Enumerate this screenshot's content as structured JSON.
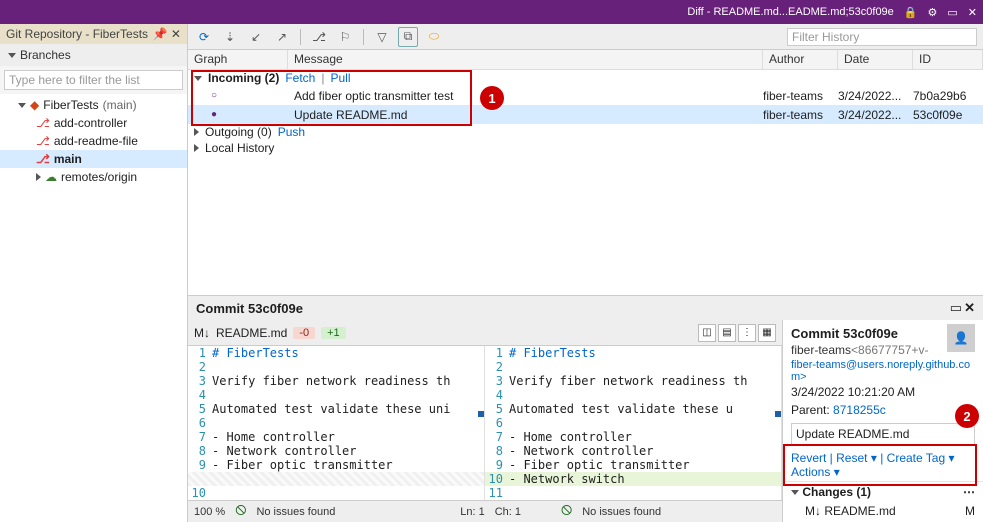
{
  "titlebar": {
    "diff_label": "Diff - README.md...EADME.md;53c0f09e"
  },
  "left": {
    "tab_title": "Git Repository - FiberTests",
    "branches_label": "Branches",
    "filter_placeholder": "Type here to filter the list",
    "repo_name": "FiberTests",
    "repo_branch_suffix": "(main)",
    "branches": [
      "add-controller",
      "add-readme-file",
      "main"
    ],
    "remotes_label": "remotes/origin"
  },
  "toolbar": {
    "filter_history_placeholder": "Filter History"
  },
  "columns": {
    "graph": "Graph",
    "message": "Message",
    "author": "Author",
    "date": "Date",
    "id": "ID"
  },
  "history": {
    "incoming_label": "Incoming (2)",
    "fetch_label": "Fetch",
    "pull_label": "Pull",
    "rows": [
      {
        "message": "Add fiber optic transmitter test",
        "author": "fiber-teams",
        "date": "3/24/2022...",
        "id": "7b0a29b6"
      },
      {
        "message": "Update README.md",
        "author": "fiber-teams",
        "date": "3/24/2022...",
        "id": "53c0f09e"
      }
    ],
    "outgoing_label": "Outgoing (0)",
    "push_label": "Push",
    "local_history_label": "Local History"
  },
  "commit": {
    "header": "Commit 53c0f09e",
    "file": "README.md",
    "removed": "-0",
    "added": "+1",
    "left_lines": [
      "# FiberTests",
      "",
      "Verify fiber network readiness th",
      "",
      "Automated test validate these uni",
      "",
      "- Home controller",
      "- Network controller",
      "- Fiber optic transmitter"
    ],
    "left_del_line_no": "",
    "left_trailing_no": "10",
    "right_lines": [
      "# FiberTests",
      "",
      "Verify fiber network readiness th",
      "",
      "Automated test validate these u",
      "",
      "- Home controller",
      "- Network controller",
      "- Fiber optic transmitter",
      "- Network switch",
      ""
    ],
    "added_index": 10
  },
  "statusbar": {
    "zoom": "100 %",
    "issues": "No issues found",
    "ln": "Ln: 1",
    "ch": "Ch: 1",
    "issues2": "No issues found"
  },
  "details": {
    "header": "Commit 53c0f09e",
    "author": "fiber-teams",
    "author_id": "<86677757+v-",
    "email": "fiber-teams@users.noreply.github.com>",
    "date": "3/24/2022 10:21:20 AM",
    "parent_label": "Parent:",
    "parent_hash": "8718255c",
    "message": "Update README.md",
    "revert": "Revert",
    "reset": "Reset",
    "create_tag": "Create Tag",
    "actions": "Actions",
    "changes_label": "Changes (1)",
    "change_file": "README.md",
    "change_status": "M"
  },
  "annotations": {
    "a1": "1",
    "a2": "2"
  }
}
